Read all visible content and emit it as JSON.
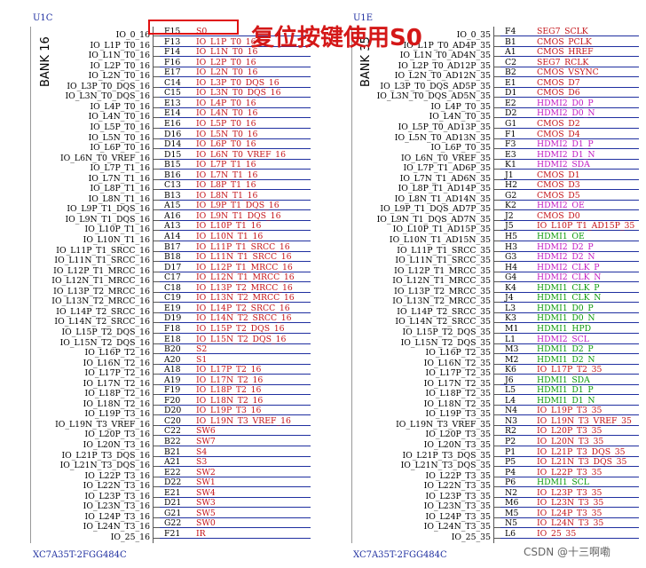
{
  "left_symbol": {
    "ref": "U1C",
    "bank": "BANK 16",
    "part": "XC7A35T-2FGG484C",
    "pins": [
      {
        "name": "IO_0_16",
        "num": "F15",
        "net": "S0",
        "color": "red"
      },
      {
        "name": "IO_L1P_T0_16",
        "num": "F13",
        "net": "IO_L1P_T0_16",
        "color": "red"
      },
      {
        "name": "IO_L1N_T0_16",
        "num": "F14",
        "net": "IO_L1N_T0_16",
        "color": "red"
      },
      {
        "name": "IO_L2P_T0_16",
        "num": "F16",
        "net": "IO_L2P_T0_16",
        "color": "red"
      },
      {
        "name": "IO_L2N_T0_16",
        "num": "E17",
        "net": "IO_L2N_T0_16",
        "color": "red"
      },
      {
        "name": "IO_L3P_T0_DQS_16",
        "num": "C14",
        "net": "IO_L3P_T0_DQS_16",
        "color": "red"
      },
      {
        "name": "IO_L3N_T0_DQS_16",
        "num": "C15",
        "net": "IO_L3N_T0_DQS_16",
        "color": "red"
      },
      {
        "name": "IO_L4P_T0_16",
        "num": "E13",
        "net": "IO_L4P_T0_16",
        "color": "red"
      },
      {
        "name": "IO_L4N_T0_16",
        "num": "E14",
        "net": "IO_L4N_T0_16",
        "color": "red"
      },
      {
        "name": "IO_L5P_T0_16",
        "num": "E16",
        "net": "IO_L5P_T0_16",
        "color": "red"
      },
      {
        "name": "IO_L5N_T0_16",
        "num": "D16",
        "net": "IO_L5N_T0_16",
        "color": "red"
      },
      {
        "name": "IO_L6P_T0_16",
        "num": "D14",
        "net": "IO_L6P_T0_16",
        "color": "red"
      },
      {
        "name": "IO_L6N_T0_VREF_16",
        "num": "D15",
        "net": "IO_L6N_T0_VREF_16",
        "color": "red"
      },
      {
        "name": "IO_L7P_T1_16",
        "num": "B15",
        "net": "IO_L7P_T1_16",
        "color": "red"
      },
      {
        "name": "IO_L7N_T1_16",
        "num": "B16",
        "net": "IO_L7N_T1_16",
        "color": "red"
      },
      {
        "name": "IO_L8P_T1_16",
        "num": "C13",
        "net": "IO_L8P_T1_16",
        "color": "red"
      },
      {
        "name": "IO_L8N_T1_16",
        "num": "B13",
        "net": "IO_L8N_T1_16",
        "color": "red"
      },
      {
        "name": "IO_L9P_T1_DQS_16",
        "num": "A15",
        "net": "IO_L9P_T1_DQS_16",
        "color": "red"
      },
      {
        "name": "IO_L9N_T1_DQS_16",
        "num": "A16",
        "net": "IO_L9N_T1_DQS_16",
        "color": "red"
      },
      {
        "name": "IO_L10P_T1_16",
        "num": "A13",
        "net": "IO_L10P_T1_16",
        "color": "red"
      },
      {
        "name": "IO_L10N_T1_16",
        "num": "A14",
        "net": "IO_L10N_T1_16",
        "color": "red"
      },
      {
        "name": "IO_L11P_T1_SRCC_16",
        "num": "B17",
        "net": "IO_L11P_T1_SRCC_16",
        "color": "red"
      },
      {
        "name": "IO_L11N_T1_SRCC_16",
        "num": "B18",
        "net": "IO_L11N_T1_SRCC_16",
        "color": "red"
      },
      {
        "name": "IO_L12P_T1_MRCC_16",
        "num": "D17",
        "net": "IO_L12P_T1_MRCC_16",
        "color": "red"
      },
      {
        "name": "IO_L12N_T1_MRCC_16",
        "num": "C17",
        "net": "IO_L12N_T1_MRCC_16",
        "color": "red"
      },
      {
        "name": "IO_L13P_T2_MRCC_16",
        "num": "C18",
        "net": "IO_L13P_T2_MRCC_16",
        "color": "red"
      },
      {
        "name": "IO_L13N_T2_MRCC_16",
        "num": "C19",
        "net": "IO_L13N_T2_MRCC_16",
        "color": "red"
      },
      {
        "name": "IO_L14P_T2_SRCC_16",
        "num": "E19",
        "net": "IO_L14P_T2_SRCC_16",
        "color": "red"
      },
      {
        "name": "IO_L14N_T2_SRCC_16",
        "num": "D19",
        "net": "IO_L14N_T2_SRCC_16",
        "color": "red"
      },
      {
        "name": "IO_L15P_T2_DQS_16",
        "num": "F18",
        "net": "IO_L15P_T2_DQS_16",
        "color": "red"
      },
      {
        "name": "IO_L15N_T2_DQS_16",
        "num": "E18",
        "net": "IO_L15N_T2_DQS_16",
        "color": "red"
      },
      {
        "name": "IO_L16P_T2_16",
        "num": "B20",
        "net": "S2",
        "color": "red"
      },
      {
        "name": "IO_L16N_T2_16",
        "num": "A20",
        "net": "S1",
        "color": "red"
      },
      {
        "name": "IO_L17P_T2_16",
        "num": "A18",
        "net": "IO_L17P_T2_16",
        "color": "red"
      },
      {
        "name": "IO_L17N_T2_16",
        "num": "A19",
        "net": "IO_L17N_T2_16",
        "color": "red"
      },
      {
        "name": "IO_L18P_T2_16",
        "num": "F19",
        "net": "IO_L18P_T2_16",
        "color": "red"
      },
      {
        "name": "IO_L18N_T2_16",
        "num": "F20",
        "net": "IO_L18N_T2_16",
        "color": "red"
      },
      {
        "name": "IO_L19P_T3_16",
        "num": "D20",
        "net": "IO_L19P_T3_16",
        "color": "red"
      },
      {
        "name": "IO_L19N_T3_VREF_16",
        "num": "C20",
        "net": "IO_L19N_T3_VREF_16",
        "color": "red"
      },
      {
        "name": "IO_L20P_T3_16",
        "num": "C22",
        "net": "SW6",
        "color": "red"
      },
      {
        "name": "IO_L20N_T3_16",
        "num": "B22",
        "net": "SW7",
        "color": "red"
      },
      {
        "name": "IO_L21P_T3_DQS_16",
        "num": "B21",
        "net": "S4",
        "color": "red"
      },
      {
        "name": "IO_L21N_T3_DQS_16",
        "num": "A21",
        "net": "S3",
        "color": "red"
      },
      {
        "name": "IO_L22P_T3_16",
        "num": "E22",
        "net": "SW2",
        "color": "red"
      },
      {
        "name": "IO_L22N_T3_16",
        "num": "D22",
        "net": "SW1",
        "color": "red"
      },
      {
        "name": "IO_L23P_T3_16",
        "num": "E21",
        "net": "SW4",
        "color": "red"
      },
      {
        "name": "IO_L23N_T3_16",
        "num": "D21",
        "net": "SW3",
        "color": "red"
      },
      {
        "name": "IO_L24P_T3_16",
        "num": "G21",
        "net": "SW5",
        "color": "red"
      },
      {
        "name": "IO_L24N_T3_16",
        "num": "G22",
        "net": "SW0",
        "color": "red"
      },
      {
        "name": "IO_25_16",
        "num": "F21",
        "net": "IR",
        "color": "red"
      }
    ]
  },
  "right_symbol": {
    "ref": "U1E",
    "bank": "BANK 35",
    "part": "XC7A35T-2FGG484C",
    "pins": [
      {
        "name": "IO_0_35",
        "num": "F4",
        "net": "SEG7_SCLK",
        "color": "red"
      },
      {
        "name": "IO_L1P_T0_AD4P_35",
        "num": "B1",
        "net": "CMOS_PCLK",
        "color": "red"
      },
      {
        "name": "IO_L1N_T0_AD4N_35",
        "num": "A1",
        "net": "CMOS_HREF",
        "color": "red"
      },
      {
        "name": "IO_L2P_T0_AD12P_35",
        "num": "C2",
        "net": "SEG7_RCLK",
        "color": "red"
      },
      {
        "name": "IO_L2N_T0_AD12N_35",
        "num": "B2",
        "net": "CMOS_VSYNC",
        "color": "red"
      },
      {
        "name": "IO_L3P_T0_DQS_AD5P_35",
        "num": "E1",
        "net": "CMOS_D7",
        "color": "red"
      },
      {
        "name": "IO_L3N_T0_DQS_AD5N_35",
        "num": "D1",
        "net": "CMOS_D6",
        "color": "red"
      },
      {
        "name": "IO_L4P_T0_35",
        "num": "E2",
        "net": "HDMI2_D0_P",
        "color": "magenta"
      },
      {
        "name": "IO_L4N_T0_35",
        "num": "D2",
        "net": "HDMI2_D0_N",
        "color": "magenta"
      },
      {
        "name": "IO_L5P_T0_AD13P_35",
        "num": "G1",
        "net": "CMOS_D2",
        "color": "red"
      },
      {
        "name": "IO_L5N_T0_AD13N_35",
        "num": "F1",
        "net": "CMOS_D4",
        "color": "red"
      },
      {
        "name": "IO_L6P_T0_35",
        "num": "F3",
        "net": "HDMI2_D1_P",
        "color": "magenta"
      },
      {
        "name": "IO_L6N_T0_VREF_35",
        "num": "E3",
        "net": "HDMI2_D1_N",
        "color": "magenta"
      },
      {
        "name": "IO_L7P_T1_AD6P_35",
        "num": "K1",
        "net": "HDMI2_SDA",
        "color": "magenta"
      },
      {
        "name": "IO_L7N_T1_AD6N_35",
        "num": "J1",
        "net": "CMOS_D1",
        "color": "red"
      },
      {
        "name": "IO_L8P_T1_AD14P_35",
        "num": "H2",
        "net": "CMOS_D3",
        "color": "red"
      },
      {
        "name": "IO_L8N_T1_AD14N_35",
        "num": "G2",
        "net": "CMOS_D5",
        "color": "red"
      },
      {
        "name": "IO_L9P_T1_DQS_AD7P_35",
        "num": "K2",
        "net": "HDMI2_OE",
        "color": "magenta"
      },
      {
        "name": "IO_L9N_T1_DQS_AD7N_35",
        "num": "J2",
        "net": "CMOS_D0",
        "color": "red"
      },
      {
        "name": "IO_L10P_T1_AD15P_35",
        "num": "J5",
        "net": "IO_L10P_T1_AD15P_35",
        "color": "red"
      },
      {
        "name": "IO_L10N_T1_AD15N_35",
        "num": "H5",
        "net": "HDMI1_OE",
        "color": "green"
      },
      {
        "name": "IO_L11P_T1_SRCC_35",
        "num": "H3",
        "net": "HDMI2_D2_P",
        "color": "magenta"
      },
      {
        "name": "IO_L11N_T1_SRCC_35",
        "num": "G3",
        "net": "HDMI2_D2_N",
        "color": "magenta"
      },
      {
        "name": "IO_L12P_T1_MRCC_35",
        "num": "H4",
        "net": "HDMI2_CLK_P",
        "color": "magenta"
      },
      {
        "name": "IO_L12N_T1_MRCC_35",
        "num": "G4",
        "net": "HDMI2_CLK_N",
        "color": "magenta"
      },
      {
        "name": "IO_L13P_T2_MRCC_35",
        "num": "K4",
        "net": "HDMI1_CLK_P",
        "color": "green"
      },
      {
        "name": "IO_L13N_T2_MRCC_35",
        "num": "J4",
        "net": "HDMI1_CLK_N",
        "color": "green"
      },
      {
        "name": "IO_L14P_T2_SRCC_35",
        "num": "L3",
        "net": "HDMI1_D0_P",
        "color": "green"
      },
      {
        "name": "IO_L14N_T2_SRCC_35",
        "num": "K3",
        "net": "HDMI1_D0_N",
        "color": "green"
      },
      {
        "name": "IO_L15P_T2_DQS_35",
        "num": "M1",
        "net": "HDMI1_HPD",
        "color": "green"
      },
      {
        "name": "IO_L15N_T2_DQS_35",
        "num": "L1",
        "net": "HDMI2_SCL",
        "color": "magenta"
      },
      {
        "name": "IO_L16P_T2_35",
        "num": "M3",
        "net": "HDMI1_D2_P",
        "color": "green"
      },
      {
        "name": "IO_L16N_T2_35",
        "num": "M2",
        "net": "HDMI1_D2_N",
        "color": "green"
      },
      {
        "name": "IO_L17P_T2_35",
        "num": "K6",
        "net": "IO_L17P_T2_35",
        "color": "red"
      },
      {
        "name": "IO_L17N_T2_35",
        "num": "J6",
        "net": "HDMI1_SDA",
        "color": "green"
      },
      {
        "name": "IO_L18P_T2_35",
        "num": "L5",
        "net": "HDMI1_D1_P",
        "color": "green"
      },
      {
        "name": "IO_L18N_T2_35",
        "num": "L4",
        "net": "HDMI1_D1_N",
        "color": "green"
      },
      {
        "name": "IO_L19P_T3_35",
        "num": "N4",
        "net": "IO_L19P_T3_35",
        "color": "red"
      },
      {
        "name": "IO_L19N_T3_VREF_35",
        "num": "N3",
        "net": "IO_L19N_T3_VREF_35",
        "color": "red"
      },
      {
        "name": "IO_L20P_T3_35",
        "num": "R2",
        "net": "IO_L20P_T3_35",
        "color": "red"
      },
      {
        "name": "IO_L20N_T3_35",
        "num": "P2",
        "net": "IO_L20N_T3_35",
        "color": "red"
      },
      {
        "name": "IO_L21P_T3_DQS_35",
        "num": "P1",
        "net": "IO_L21P_T3_DQS_35",
        "color": "red"
      },
      {
        "name": "IO_L21N_T3_DQS_35",
        "num": "P5",
        "net": "IO_L21N_T3_DQS_35",
        "color": "red"
      },
      {
        "name": "IO_L22P_T3_35",
        "num": "P4",
        "net": "IO_L22P_T3_35",
        "color": "red"
      },
      {
        "name": "IO_L22N_T3_35",
        "num": "P6",
        "net": "HDMI1_SCL",
        "color": "green"
      },
      {
        "name": "IO_L23P_T3_35",
        "num": "N2",
        "net": "IO_L23P_T3_35",
        "color": "red"
      },
      {
        "name": "IO_L23N_T3_35",
        "num": "M6",
        "net": "IO_L23N_T3_35",
        "color": "red"
      },
      {
        "name": "IO_L24P_T3_35",
        "num": "M5",
        "net": "IO_L24P_T3_35",
        "color": "red"
      },
      {
        "name": "IO_L24N_T3_35",
        "num": "N5",
        "net": "IO_L24N_T3_35",
        "color": "red"
      },
      {
        "name": "IO_25_35",
        "num": "L6",
        "net": "IO_25_35",
        "color": "red"
      }
    ]
  },
  "callout": {
    "text": "复位按键使用S0",
    "color": "#d41818",
    "box_color": "#e01010"
  },
  "watermark": "CSDN @十三啊嘞",
  "colors": {
    "red": "#c4141a",
    "magenta": "#c21bc2",
    "green": "#0e9a0e",
    "blue": "#1f2fa0"
  }
}
